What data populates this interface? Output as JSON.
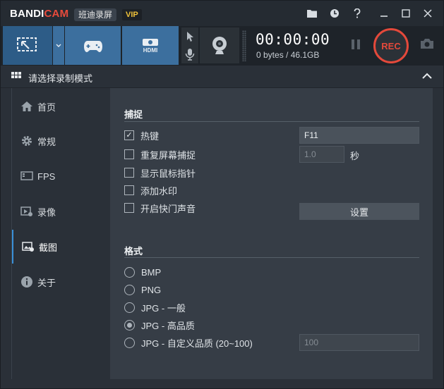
{
  "app": {
    "logo_a": "BANDI",
    "logo_b": "CAM",
    "brand_cn": "班迪录屏",
    "vip": "VIP"
  },
  "titlebar_icons": [
    "folder-icon",
    "clock-icon",
    "help-icon",
    "minimize-icon",
    "restore-icon",
    "close-icon"
  ],
  "toolbar": {
    "hdmi_label": "HDMI",
    "timer": "00:00:00",
    "size": "0 bytes / 46.1GB",
    "rec_label": "REC"
  },
  "modebar": {
    "title": "请选择录制模式"
  },
  "sidebar": {
    "items": [
      {
        "label": "首页",
        "icon": "home-icon"
      },
      {
        "label": "常规",
        "icon": "gear-icon"
      },
      {
        "label": "FPS",
        "icon": "fps-icon"
      },
      {
        "label": "录像",
        "icon": "video-icon"
      },
      {
        "label": "截图",
        "icon": "screenshot-icon"
      },
      {
        "label": "关于",
        "icon": "info-icon"
      }
    ],
    "active": "截图"
  },
  "capture": {
    "title": "捕捉",
    "options": [
      {
        "label": "热键",
        "checked": true
      },
      {
        "label": "重复屏幕捕捉",
        "checked": false
      },
      {
        "label": "显示鼠标指针",
        "checked": false
      },
      {
        "label": "添加水印",
        "checked": false
      },
      {
        "label": "开启快门声音",
        "checked": false
      }
    ],
    "hotkey_value": "F11",
    "repeat_value": "1.0",
    "repeat_unit": "秒",
    "settings_button": "设置"
  },
  "format": {
    "title": "格式",
    "options": [
      {
        "label": "BMP",
        "selected": false
      },
      {
        "label": "PNG",
        "selected": false
      },
      {
        "label": "JPG - 一般",
        "selected": false
      },
      {
        "label": "JPG - 高品质",
        "selected": true
      },
      {
        "label": "JPG - 自定义品质 (20~100)",
        "selected": false
      }
    ],
    "quality_value": "100"
  },
  "colors": {
    "accent": "#3a90d8",
    "rec": "#e4493b",
    "mode_button": "#3c6f9e",
    "vip": "#f0c23a"
  }
}
